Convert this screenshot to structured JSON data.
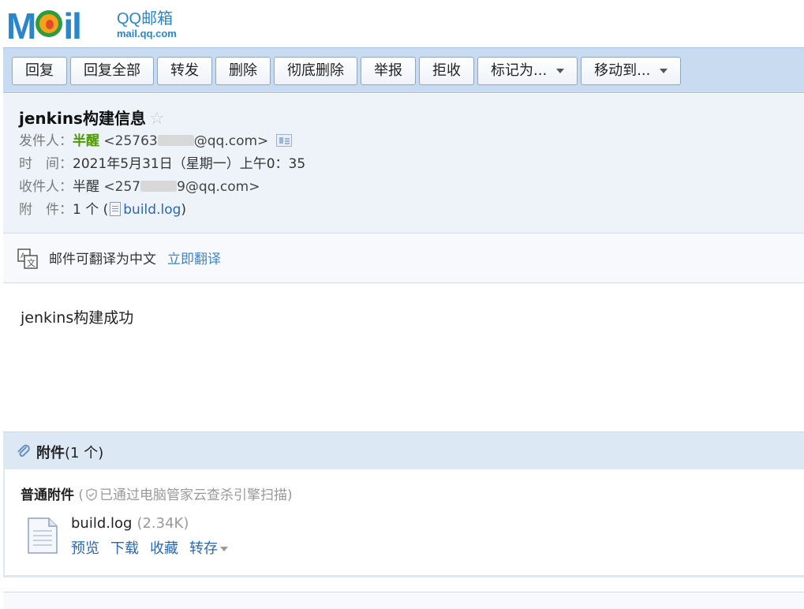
{
  "logo": {
    "mark": "Mail",
    "brand": "QQ邮箱",
    "domain": "mail.qq.com"
  },
  "toolbar": {
    "buttons": [
      "回复",
      "回复全部",
      "转发",
      "删除",
      "彻底删除",
      "举报",
      "拒收"
    ],
    "mark_as": "标记为...",
    "move_to": "移动到..."
  },
  "mail": {
    "subject": "jenkins构建信息",
    "from_label": "发件人：",
    "from_name": "半醒",
    "from_addr_prefix": "<25763",
    "from_addr_suffix": "@qq.com>",
    "time_label": "时　间：",
    "time_value": "2021年5月31日（星期一）上午0：35",
    "to_label": "收件人：",
    "to_name": "半醒",
    "to_addr_prefix": "<257",
    "to_addr_suffix": "9@qq.com>",
    "att_label": "附　件：",
    "att_count": "1 个 (",
    "att_link": "build.log",
    "att_close": ")",
    "body": "jenkins构建成功"
  },
  "translate": {
    "text": "邮件可翻译为中文",
    "action": "立即翻译"
  },
  "attachments": {
    "title": "附件",
    "count": "(1 个)",
    "type_label": "普通附件",
    "scan_open": "(",
    "scan_text": "已通过电脑管家云查杀引擎扫描)",
    "file_name": "build.log",
    "file_size": "(2.34K)",
    "actions": [
      "预览",
      "下载",
      "收藏",
      "转存"
    ]
  }
}
